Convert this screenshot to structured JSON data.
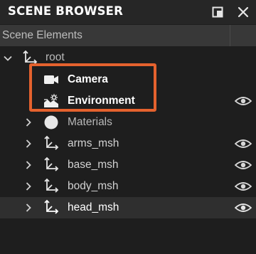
{
  "panel": {
    "title": "SCENE BROWSER",
    "section_title": "Scene Elements"
  },
  "tree": {
    "root_label": "root",
    "camera_label": "Camera",
    "environment_label": "Environment",
    "materials_label": "Materials",
    "arms_label": "arms_msh",
    "base_label": "base_msh",
    "body_label": "body_msh",
    "head_label": "head_msh"
  },
  "icons": {
    "maximize": "maximize-icon",
    "close": "close-icon",
    "expand": "chevron-right-icon",
    "collapse": "chevron-down-icon",
    "transform": "transform-axes-icon",
    "camera": "camera-icon",
    "environment": "environment-icon",
    "material": "material-sphere-icon",
    "visibility": "eye-icon"
  },
  "colors": {
    "accent_highlight": "#e5622e",
    "background": "#1e1e1e",
    "header": "#262626",
    "section_bar": "#383838",
    "selected_row": "#2f2f2f"
  }
}
